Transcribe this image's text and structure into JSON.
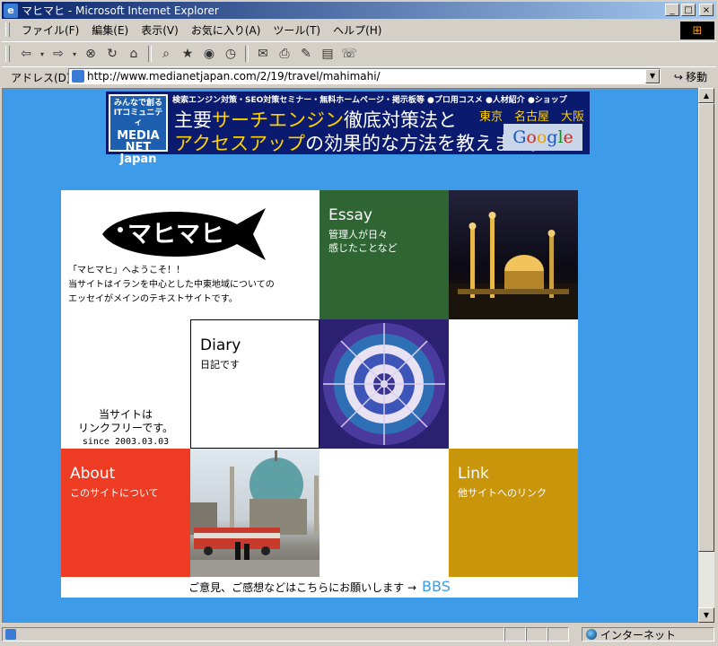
{
  "window": {
    "title": "マヒマヒ - Microsoft Internet Explorer"
  },
  "menu": [
    "ファイル(F)",
    "編集(E)",
    "表示(V)",
    "お気に入り(A)",
    "ツール(T)",
    "ヘルプ(H)"
  ],
  "address": {
    "label": "アドレス(D)",
    "url": "http://www.medianetjapan.com/2/19/travel/mahimahi/",
    "go": "移動"
  },
  "status": {
    "zone": "インターネット"
  },
  "banner": {
    "logo_top": "みんなで創る ITコミュニティ",
    "logo_name": "MEDIA NET Japan",
    "topline": "検索エンジン対策・SEO対策セミナー・無料ホームページ・掲示板等 ●プロ用コスメ ●人材紹介 ●ショップ",
    "line1_a": "主要",
    "line1_b": "サーチエンジン",
    "line1_c": "徹底対策法と",
    "line2_a": "アクセスアップ",
    "line2_b": "の効果的な方法を教えます。",
    "cities": "東京　名古屋　大阪",
    "google": "Google"
  },
  "site": {
    "logo_text": "マヒマヒ",
    "intro": [
      "「マヒマヒ」へようこそ！！",
      "当サイトはイランを中心とした中東地域についての",
      "エッセイがメインのテキストサイトです。"
    ],
    "essay": {
      "title": "Essay",
      "desc1": "管理人が日々",
      "desc2": "感じたことなど"
    },
    "diary": {
      "title": "Diary",
      "desc": "日記です"
    },
    "about": {
      "title": "About",
      "desc": "このサイトについて"
    },
    "link": {
      "title": "Link",
      "desc": "他サイトへのリンク"
    },
    "linkfree": [
      "当サイトは",
      "リンクフリーです。",
      "since 2003.03.03"
    ],
    "footer": "ご意見、ご感想などはこちらにお願いします →",
    "bbs": "BBS"
  },
  "colors": {
    "page_bg": "#3d9be9",
    "essay": "#2e6533",
    "about": "#ee3b23",
    "link": "#c9950a"
  }
}
